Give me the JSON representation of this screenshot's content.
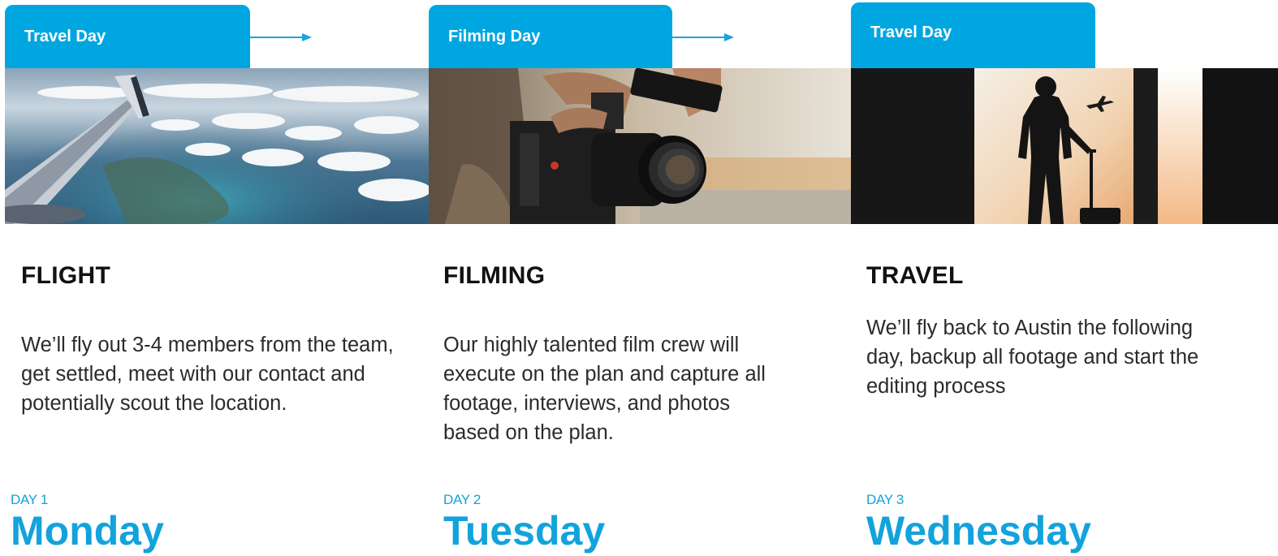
{
  "accent_color": "#00a6e0",
  "days": [
    {
      "tab_label": "Travel Day",
      "image": "airplane-wing-over-clouds-image",
      "heading": "FLIGHT",
      "description": "We’ll fly out 3-4 members from the team, get settled, meet with our contact and potentially scout the location.",
      "day_number": "DAY 1",
      "day_name": "Monday"
    },
    {
      "tab_label": "Filming Day",
      "image": "cinema-camera-image",
      "heading": "FILMING",
      "description": "Our highly talented film crew will execute on the plan and capture all footage, interviews, and photos based on the plan.",
      "day_number": "DAY 2",
      "day_name": "Tuesday"
    },
    {
      "tab_label": "Travel Day",
      "image": "traveler-silhouette-with-luggage-image",
      "heading": "TRAVEL",
      "description": "We’ll fly back to Austin the following day, backup all footage and start the editing process",
      "day_number": "DAY 3",
      "day_name": "Wednesday"
    }
  ]
}
